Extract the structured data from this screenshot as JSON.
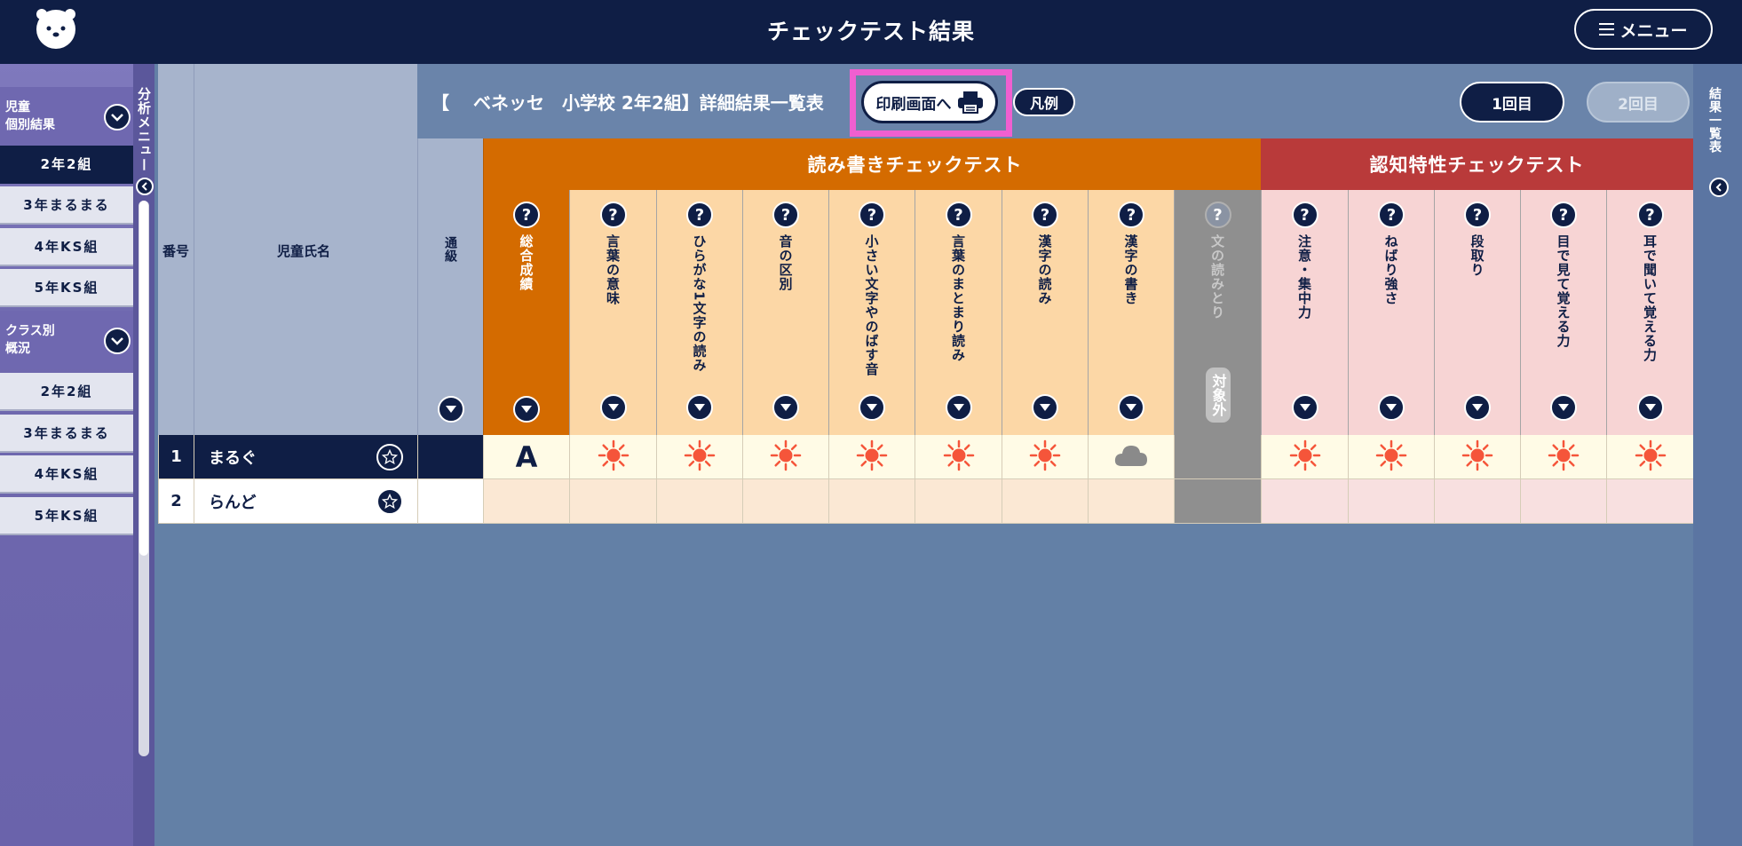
{
  "header": {
    "title": "チェックテスト結果",
    "menu_label": "メニュー"
  },
  "sidebar": {
    "vertical_label": "分析メニュー",
    "group1": {
      "label_line1": "児童",
      "label_line2": "個別結果"
    },
    "group1_items": [
      "2年2組",
      "3年まるまる",
      "4年KS組",
      "5年KS組"
    ],
    "group2": {
      "label_line1": "クラス別",
      "label_line2": "概況"
    },
    "group2_items": [
      "2年2組",
      "3年まるまる",
      "4年KS組",
      "5年KS組"
    ]
  },
  "right_panel": {
    "vertical_label": "結果一覧表"
  },
  "main": {
    "title": "【　 ベネッセ　小学校 2年2組】詳細結果一覧表",
    "print_button": "印刷画面へ",
    "legend_button": "凡例",
    "round1_button": "1回目",
    "round2_button": "2回目",
    "col_number": "番号",
    "col_name": "児童氏名",
    "col_tsukyu": "通級",
    "col_overall": "総合成績",
    "group_read_write": "読み書きチェックテスト",
    "group_cognitive": "認知特性チェックテスト",
    "rw_columns": [
      "言葉の意味",
      "ひらがな1文字の読み",
      "音の区別",
      "小さい文字やのばす音",
      "言葉のまとまり読み",
      "漢字の読み",
      "漢字の書き",
      "文の読みとり"
    ],
    "cog_columns": [
      "注意・集中力",
      "ねばり強さ",
      "段取り",
      "目で見て覚える力",
      "耳で聞いて覚える力"
    ],
    "excluded_label": "対象外",
    "rows": [
      {
        "num": "1",
        "name": "まるぐ",
        "overall": "A",
        "rw": [
          "sun",
          "sun",
          "sun",
          "sun",
          "sun",
          "sun",
          "cloud",
          "none"
        ],
        "cog": [
          "sun",
          "sun",
          "sun",
          "sun",
          "sun"
        ]
      },
      {
        "num": "2",
        "name": "らんど",
        "overall": "",
        "rw": [
          "none",
          "none",
          "none",
          "none",
          "none",
          "none",
          "none",
          "none"
        ],
        "cog": [
          "none",
          "none",
          "none",
          "none",
          "none"
        ]
      }
    ]
  },
  "colors": {
    "navy": "#0f1e45",
    "rw_header": "#d46b00",
    "cog_header": "#b93a3a",
    "highlight": "#f05fd0",
    "sun": "#f5553a"
  }
}
